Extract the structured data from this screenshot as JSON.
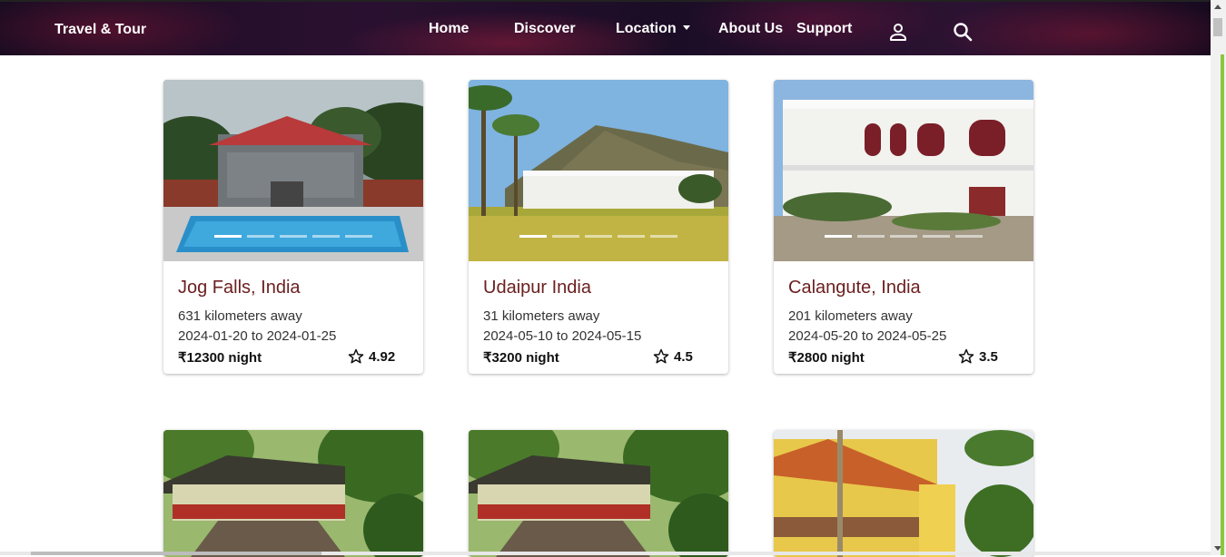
{
  "navbar": {
    "brand": "Travel & Tour",
    "links": {
      "home": "Home",
      "discover": "Discover",
      "location": "Location",
      "about": "About Us",
      "support": "Support"
    },
    "icons": [
      "user-icon",
      "search-icon"
    ]
  },
  "listings": [
    {
      "title": "Jog Falls, India",
      "distance": "631 kilometers away",
      "dates": "2024-01-20 to 2024-01-25",
      "price": "₹12300 night",
      "rating": "4.92"
    },
    {
      "title": "Udaipur India",
      "distance": "31 kilometers away",
      "dates": "2024-05-10 to 2024-05-15",
      "price": "₹3200 night",
      "rating": "4.5"
    },
    {
      "title": "Calangute, India",
      "distance": "201 kilometers away",
      "dates": "2024-05-20 to 2024-05-25",
      "price": "₹2800 night",
      "rating": "3.5"
    }
  ],
  "colors": {
    "title": "#6b2020",
    "accent": "#8dc63f"
  }
}
